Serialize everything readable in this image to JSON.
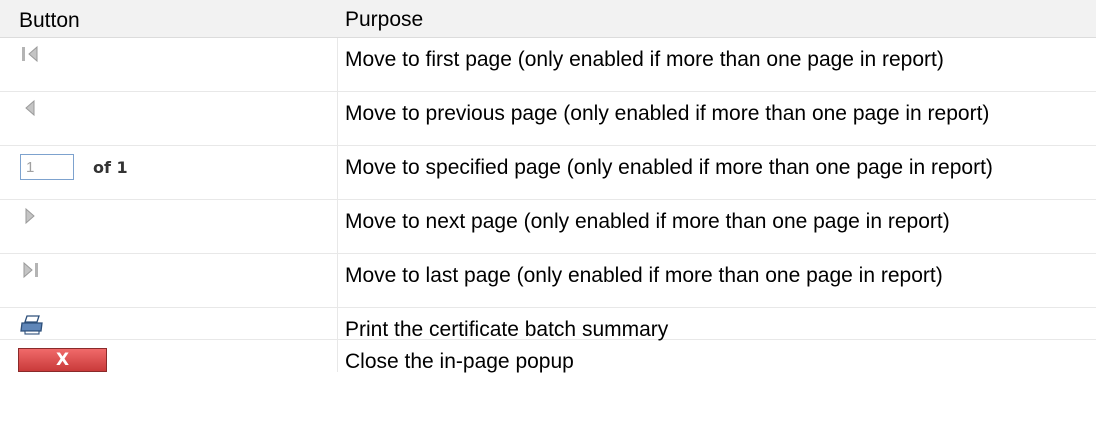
{
  "table": {
    "headers": {
      "button": "Button",
      "purpose": "Purpose"
    },
    "rows": [
      {
        "control": "first-page-icon",
        "purpose": "Move to first page (only enabled if more than one page in report)"
      },
      {
        "control": "previous-page-icon",
        "purpose": "Move to previous page (only enabled if more than one page in report)"
      },
      {
        "control": "page-number-input",
        "purpose": "Move to specified page (only enabled if more than one page in report)"
      },
      {
        "control": "next-page-icon",
        "purpose": "Move to next page (only enabled if more than one page in report)"
      },
      {
        "control": "last-page-icon",
        "purpose": "Move to last page (only enabled if more than one page in report)"
      },
      {
        "control": "print-icon",
        "purpose": "Print the certificate batch summary"
      },
      {
        "control": "close-button",
        "purpose": "Close the in-page popup"
      }
    ]
  },
  "page_control": {
    "value": "1",
    "of_text": "of 1"
  },
  "close_button": {
    "label": "X"
  },
  "colors": {
    "header_bg": "#f2f2f2",
    "nav_icon": "#b4b4b4",
    "input_border": "#7da2ce",
    "close_button": "#d94848"
  }
}
